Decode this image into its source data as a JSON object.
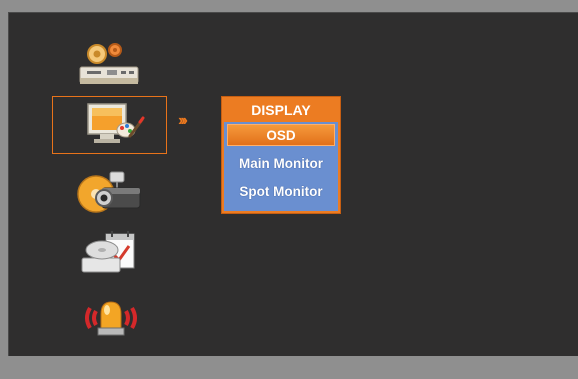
{
  "main_menu": {
    "items": [
      {
        "icon": "system-setup-icon",
        "selected": false
      },
      {
        "icon": "display-icon",
        "selected": true
      },
      {
        "icon": "camera-icon",
        "selected": false
      },
      {
        "icon": "record-schedule-icon",
        "selected": false
      },
      {
        "icon": "alarm-icon",
        "selected": false
      }
    ]
  },
  "arrow_text": "›››",
  "submenu": {
    "title": "DISPLAY",
    "items": [
      {
        "label": "OSD",
        "selected": true
      },
      {
        "label": "Main Monitor",
        "selected": false
      },
      {
        "label": "Spot Monitor",
        "selected": false
      }
    ]
  },
  "colors": {
    "accent": "#ec7c22",
    "submenu_list_bg": "#6a8fd0",
    "panel_bg": "#2f2e2e",
    "frame_bg": "#8f8f8f"
  }
}
